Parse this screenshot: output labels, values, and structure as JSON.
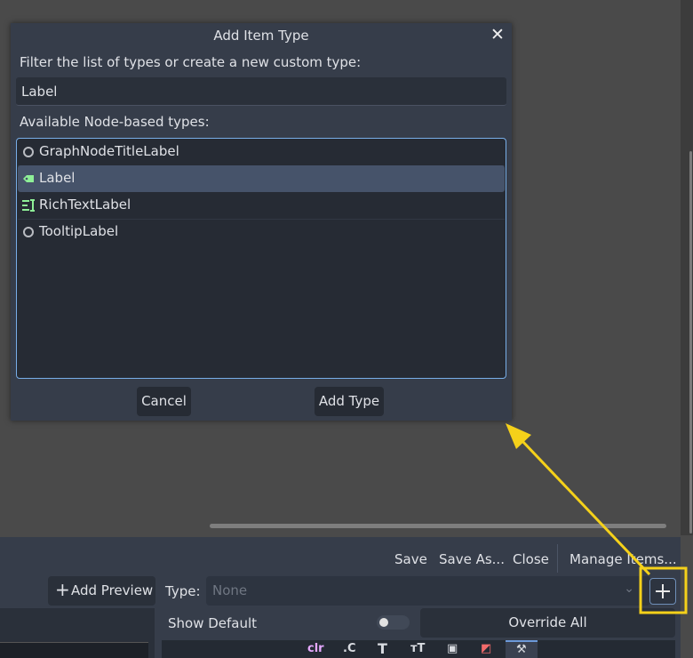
{
  "dialog": {
    "title": "Add Item Type",
    "filter_label": "Filter the list of types or create a new custom type:",
    "filter_value": "Label",
    "list_label": "Available Node-based types:",
    "items": [
      {
        "label": "GraphNodeTitleLabel",
        "icon": "circle-icon",
        "selected": false
      },
      {
        "label": "Label",
        "icon": "label-tag-icon",
        "selected": true
      },
      {
        "label": "RichTextLabel",
        "icon": "richtext-icon",
        "selected": false
      },
      {
        "label": "TooltipLabel",
        "icon": "circle-icon",
        "selected": false
      }
    ],
    "cancel_label": "Cancel",
    "add_label": "Add Type"
  },
  "toolbar": {
    "save": "Save",
    "save_as": "Save As...",
    "close": "Close",
    "manage": "Manage Items..."
  },
  "preview": {
    "add_preview": "Add Preview",
    "type_label": "Type:",
    "type_placeholder": "None",
    "show_default": "Show Default",
    "override_all": "Override All"
  },
  "colors": {
    "accent": "#78aee8",
    "annotation": "#f5d11a",
    "label_icon": "#8eef97"
  }
}
